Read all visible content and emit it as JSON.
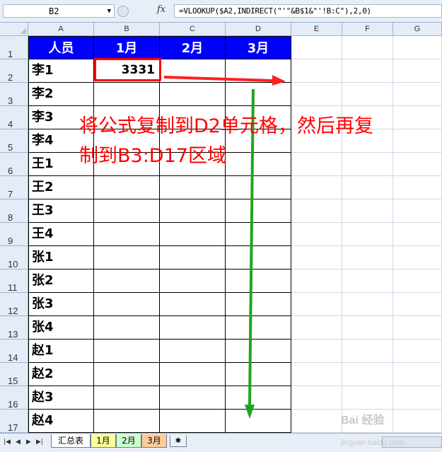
{
  "formula_bar": {
    "name_box": "B2",
    "fx_label": "fx",
    "formula": "=VLOOKUP($A2,INDIRECT(\"'\"&B$1&\"'!B:C\"),2,0)"
  },
  "columns": [
    "A",
    "B",
    "C",
    "D",
    "E",
    "F",
    "G"
  ],
  "rows": [
    "1",
    "2",
    "3",
    "4",
    "5",
    "6",
    "7",
    "8",
    "9",
    "10",
    "11",
    "12",
    "13",
    "14",
    "15",
    "16",
    "17"
  ],
  "table": {
    "headers": [
      "人员",
      "1月",
      "2月",
      "3月"
    ],
    "names": [
      "李1",
      "李2",
      "李3",
      "李4",
      "王1",
      "王2",
      "王3",
      "王4",
      "张1",
      "张2",
      "张3",
      "张4",
      "赵1",
      "赵2",
      "赵3",
      "赵4"
    ],
    "b2_value": "3331"
  },
  "annotation": {
    "line1": "将公式复制到D2单元格，然后再复",
    "line2": "制到B3:D17区域"
  },
  "sheet_tabs": [
    "汇总表",
    "1月",
    "2月",
    "3月"
  ],
  "watermark": {
    "brand": "Bai 经验",
    "url": "jingyan.baidu.com"
  },
  "colors": {
    "header_fill": "#0000ff",
    "highlight": "#ff0000",
    "arrow_down": "#1fa51f",
    "tab_1": "#ffff99",
    "tab_2": "#ccffcc",
    "tab_3": "#ffcc99"
  }
}
